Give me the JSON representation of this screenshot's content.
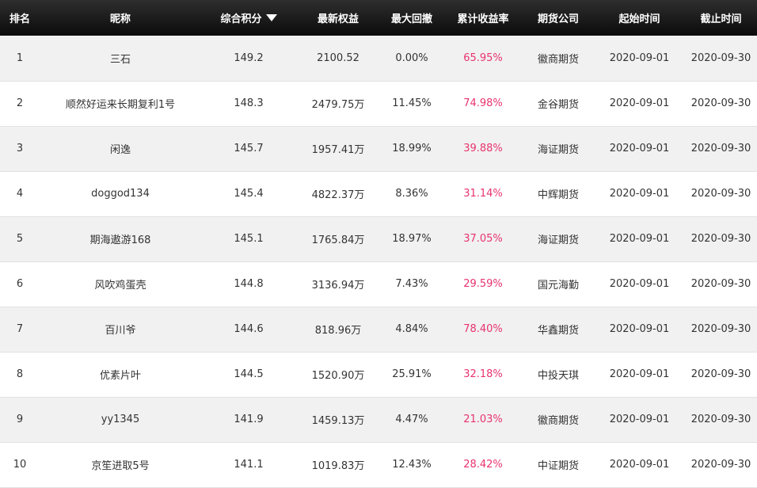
{
  "table": {
    "headers": {
      "rank": "排名",
      "nickname": "昵称",
      "score": "综合积分",
      "equity": "最新权益",
      "drawdown": "最大回撤",
      "yield": "累计收益率",
      "company": "期货公司",
      "start": "起始时间",
      "end": "截止时间"
    },
    "sort_icon": "triangle-down-icon",
    "yield_color": "#e8336e",
    "rows": [
      {
        "rank": "1",
        "nickname": "三石",
        "score": "149.2",
        "equity": "2100.52",
        "drawdown": "0.00%",
        "yield": "65.95%",
        "company": "徽商期货",
        "start": "2020-09-01",
        "end": "2020-09-30"
      },
      {
        "rank": "2",
        "nickname": "顺然好运来长期复利1号",
        "score": "148.3",
        "equity": "2479.75万",
        "drawdown": "11.45%",
        "yield": "74.98%",
        "company": "金谷期货",
        "start": "2020-09-01",
        "end": "2020-09-30"
      },
      {
        "rank": "3",
        "nickname": "闲逸",
        "score": "145.7",
        "equity": "1957.41万",
        "drawdown": "18.99%",
        "yield": "39.88%",
        "company": "海证期货",
        "start": "2020-09-01",
        "end": "2020-09-30"
      },
      {
        "rank": "4",
        "nickname": "doggod134",
        "score": "145.4",
        "equity": "4822.37万",
        "drawdown": "8.36%",
        "yield": "31.14%",
        "company": "中辉期货",
        "start": "2020-09-01",
        "end": "2020-09-30"
      },
      {
        "rank": "5",
        "nickname": "期海遨游168",
        "score": "145.1",
        "equity": "1765.84万",
        "drawdown": "18.97%",
        "yield": "37.05%",
        "company": "海证期货",
        "start": "2020-09-01",
        "end": "2020-09-30"
      },
      {
        "rank": "6",
        "nickname": "风吹鸡蛋壳",
        "score": "144.8",
        "equity": "3136.94万",
        "drawdown": "7.43%",
        "yield": "29.59%",
        "company": "国元海勤",
        "start": "2020-09-01",
        "end": "2020-09-30"
      },
      {
        "rank": "7",
        "nickname": "百川爷",
        "score": "144.6",
        "equity": "818.96万",
        "drawdown": "4.84%",
        "yield": "78.40%",
        "company": "华鑫期货",
        "start": "2020-09-01",
        "end": "2020-09-30"
      },
      {
        "rank": "8",
        "nickname": "优素片叶",
        "score": "144.5",
        "equity": "1520.90万",
        "drawdown": "25.91%",
        "yield": "32.18%",
        "company": "中投天琪",
        "start": "2020-09-01",
        "end": "2020-09-30"
      },
      {
        "rank": "9",
        "nickname": "yy1345",
        "score": "141.9",
        "equity": "1459.13万",
        "drawdown": "4.47%",
        "yield": "21.03%",
        "company": "徽商期货",
        "start": "2020-09-01",
        "end": "2020-09-30"
      },
      {
        "rank": "10",
        "nickname": "京笙进取5号",
        "score": "141.1",
        "equity": "1019.83万",
        "drawdown": "12.43%",
        "yield": "28.42%",
        "company": "中证期货",
        "start": "2020-09-01",
        "end": "2020-09-30"
      }
    ]
  }
}
